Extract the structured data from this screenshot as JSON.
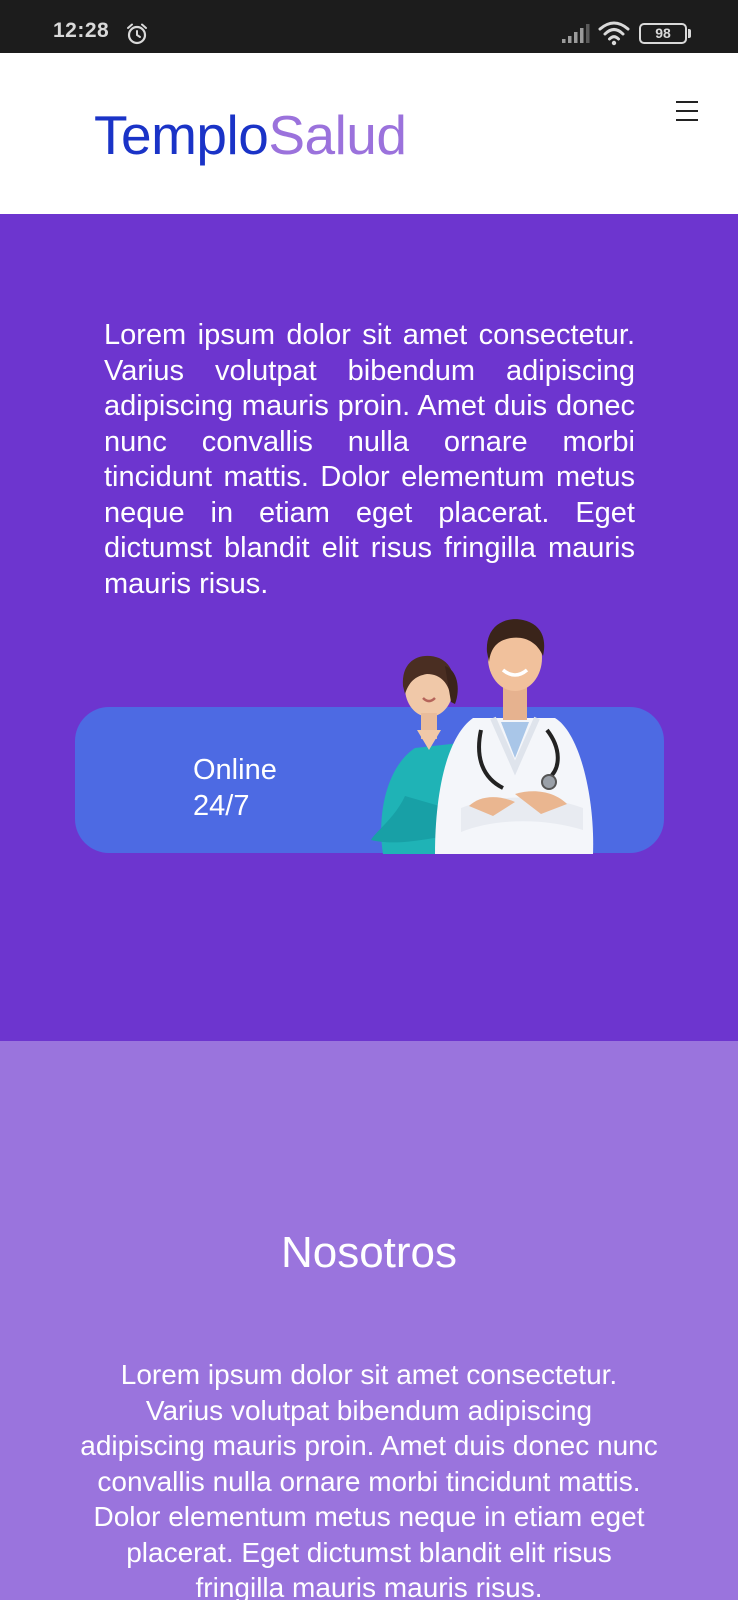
{
  "status_bar": {
    "time": "12:28",
    "battery": "98",
    "icons": [
      "alarm-icon",
      "signal-icon",
      "wifi-icon",
      "battery-icon"
    ]
  },
  "header": {
    "logo_part1": "Templo",
    "logo_part2": "Salud",
    "menu_icon": "hamburger-menu-icon",
    "colors": {
      "logo_primary": "#1a33c7",
      "logo_secondary": "#9b72dc"
    }
  },
  "hero": {
    "text": "Lorem ipsum dolor sit amet consectetur. Varius volutpat bibendum adipiscing adipiscing mauris proin. Amet duis donec nunc convallis nulla ornare morbi tincidunt mattis. Dolor elementum metus neque in etiam eget placerat. Eget dictumst blandit elit risus fringilla mauris mauris risus.",
    "card": {
      "line1": "Online",
      "line2": "24/7"
    },
    "colors": {
      "background": "#6d35cf",
      "card": "#4d6ae3"
    }
  },
  "about": {
    "title": "Nosotros",
    "text": "Lorem ipsum dolor sit amet consectetur. Varius volutpat bibendum adipiscing adipiscing mauris proin. Amet duis donec nunc convallis nulla ornare morbi tincidunt mattis. Dolor elementum metus neque in etiam eget placerat. Eget dictumst blandit elit risus fringilla mauris mauris risus.",
    "colors": {
      "background": "#9a74dd"
    }
  }
}
